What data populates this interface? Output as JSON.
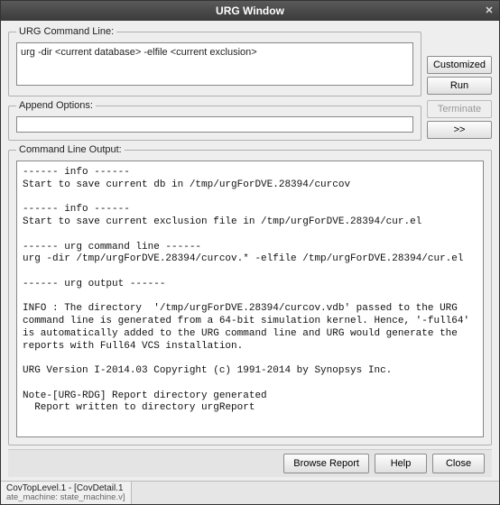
{
  "window": {
    "title": "URG Window"
  },
  "sections": {
    "command_line_label": "URG Command Line:",
    "append_options_label": "Append Options:",
    "output_label": "Command Line Output:"
  },
  "command_line": {
    "value": "urg -dir <current database> -elfile <current exclusion>"
  },
  "append": {
    "value": ""
  },
  "side_buttons": {
    "customized": "Customized",
    "run": "Run",
    "terminate": "Terminate",
    "more": ">>"
  },
  "output_text": "------ info ------\nStart to save current db in /tmp/urgForDVE.28394/curcov\n\n------ info ------\nStart to save current exclusion file in /tmp/urgForDVE.28394/cur.el\n\n------ urg command line ------\nurg -dir /tmp/urgForDVE.28394/curcov.* -elfile /tmp/urgForDVE.28394/cur.el\n\n------ urg output ------\n\nINFO : The directory  '/tmp/urgForDVE.28394/curcov.vdb' passed to the URG command line is generated from a 64-bit simulation kernel. Hence, '-full64' is automatically added to the URG command line and URG would generate the reports with Full64 VCS installation.\n\nURG Version I-2014.03 Copyright (c) 1991-2014 by Synopsys Inc.\n\nNote-[URG-RDG] Report directory generated\n  Report written to directory urgReport\n",
  "bottom_buttons": {
    "browse_report": "Browse Report",
    "help": "Help",
    "close": "Close"
  },
  "status_tabs": {
    "tab1": {
      "line1": "CovTopLevel.1 - [CovDetail.1",
      "line2": "ate_machine: state_machine.v]"
    }
  }
}
